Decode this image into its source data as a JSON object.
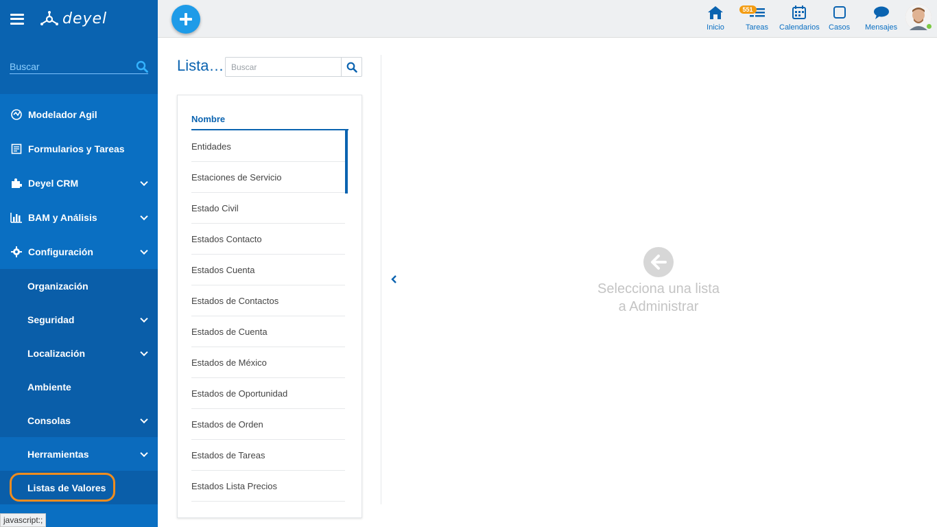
{
  "app": {
    "logo_text": "deyel"
  },
  "sidebar": {
    "search_placeholder": "Buscar",
    "items": [
      {
        "label": "Modelador Agil",
        "icon": "agile-modeler-icon"
      },
      {
        "label": "Formularios y Tareas",
        "icon": "form-icon"
      },
      {
        "label": "Deyel CRM",
        "icon": "puzzle-icon"
      },
      {
        "label": "BAM y Análisis",
        "icon": "bar-chart-icon"
      },
      {
        "label": "Configuración",
        "icon": "gear-icon"
      }
    ],
    "subitems": [
      {
        "label": "Organización"
      },
      {
        "label": "Seguridad"
      },
      {
        "label": "Localización"
      },
      {
        "label": "Ambiente"
      },
      {
        "label": "Consolas"
      },
      {
        "label": "Herramientas"
      },
      {
        "label": "Listas de Valores"
      }
    ],
    "status_tip": "javascript:;"
  },
  "topbar": {
    "items": [
      {
        "label": "Inicio",
        "icon": "home-icon"
      },
      {
        "label": "Tareas",
        "icon": "tasks-icon",
        "badge": "551"
      },
      {
        "label": "Calendarios",
        "icon": "calendar-icon"
      },
      {
        "label": "Casos",
        "icon": "cases-icon"
      },
      {
        "label": "Mensajes",
        "icon": "messages-icon"
      }
    ]
  },
  "main": {
    "title": "Lista…",
    "search_placeholder": "Buscar",
    "column_header": "Nombre",
    "rows": [
      "Entidades",
      "Estaciones de Servicio",
      "Estado Civil",
      "Estados Contacto",
      "Estados Cuenta",
      "Estados de Contactos",
      "Estados de Cuenta",
      "Estados de México",
      "Estados de Oportunidad",
      "Estados de Orden",
      "Estados de Tareas",
      "Estados Lista Precios"
    ],
    "empty_line1": "Selecciona una lista",
    "empty_line2": "a Administrar"
  },
  "colors": {
    "sidebar_bg": "#0a6fc2",
    "sidebar_header_bg": "#0a63b0",
    "accent": "#1e9be8",
    "highlight_ring": "#f08c1e",
    "badge": "#f39c12"
  }
}
